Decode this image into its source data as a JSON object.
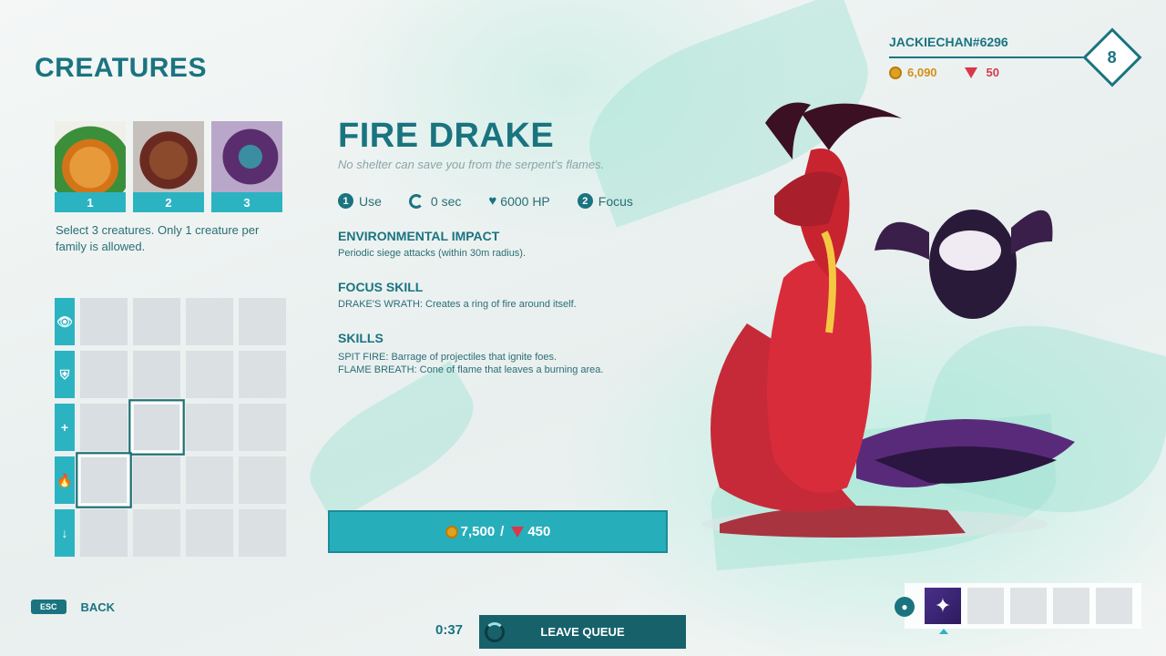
{
  "page": {
    "title": "CREATURES"
  },
  "selected": [
    {
      "num": "1",
      "portrait": "orange-creature"
    },
    {
      "num": "2",
      "portrait": "brown-wolf-creature"
    },
    {
      "num": "3",
      "portrait": "purple-cyclops-creature"
    }
  ],
  "instructions": "Select 3 creatures. Only 1 creature per family is allowed.",
  "grid": {
    "rows": [
      {
        "icon": "eye-icon",
        "glyph": "👁"
      },
      {
        "icon": "shield-icon",
        "glyph": "⛨"
      },
      {
        "icon": "plus-icon",
        "glyph": "+"
      },
      {
        "icon": "fire-icon",
        "glyph": "🔥"
      },
      {
        "icon": "arrow-down-icon",
        "glyph": "↓"
      }
    ]
  },
  "creature": {
    "name": "FIRE DRAKE",
    "tagline": "No shelter can save you from the serpent's flames.",
    "stats": {
      "use_num": "1",
      "use_label": "Use",
      "cooldown": "0 sec",
      "hp": "6000 HP",
      "focus_num": "2",
      "focus_label": "Focus"
    },
    "sections": [
      {
        "title": "ENVIRONMENTAL IMPACT",
        "lines": [
          "Periodic siege attacks (within 30m radius)."
        ]
      },
      {
        "title": "FOCUS SKILL",
        "lines": [
          "DRAKE'S WRATH: Creates a ring of fire around itself."
        ]
      },
      {
        "title": "SKILLS",
        "lines": [
          "SPIT FIRE: Barrage of projectiles that ignite foes.",
          "FLAME BREATH: Cone of flame that leaves a burning area."
        ]
      }
    ]
  },
  "price": {
    "gold": "7,500",
    "separator": "/",
    "gems": "450"
  },
  "profile": {
    "username": "JACKIECHAN#6296",
    "gold": "6,090",
    "gems": "50",
    "level": "8"
  },
  "bottom": {
    "esc_key": "ESC",
    "back_label": "BACK",
    "timer": "0:37",
    "leave_label": "LEAVE QUEUE"
  },
  "colors": {
    "accent": "#1a7480",
    "button": "#27aebb",
    "gold": "#d3901a",
    "gem": "#d83a4a"
  }
}
